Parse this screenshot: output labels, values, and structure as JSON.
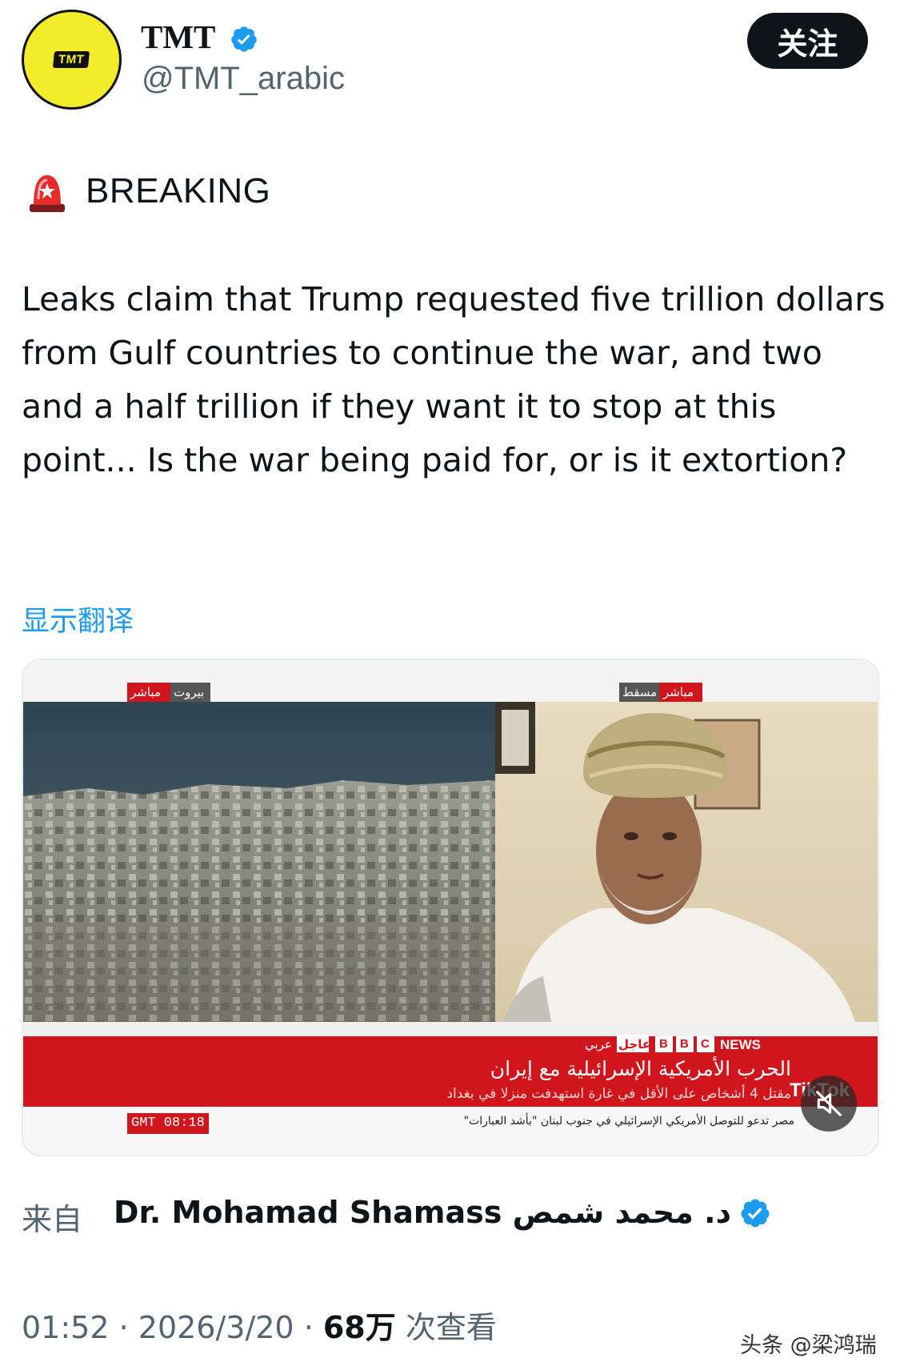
{
  "account": {
    "display_name": "TMT",
    "handle": "@TMT_arabic",
    "avatar_text": "TMT",
    "follow_label": "关注"
  },
  "tweet": {
    "breaking_label": "BREAKING",
    "text": "Leaks claim that Trump requested five trillion dollars from Gulf countries to continue the war, and two and a half trillion if they want it to stop at this point... Is the war being paid for, or is it extortion?",
    "translate_label": "显示翻译"
  },
  "media": {
    "live_tag_left": "مباشر",
    "location_tag_left": "بيروت",
    "live_tag_right": "مباشر",
    "location_tag_right": "مسقط",
    "urgent_tag": "عاجل",
    "channel_lang": "عربي",
    "bbc_letters": [
      "B",
      "B",
      "C"
    ],
    "news_label": "NEWS",
    "headline": "الحرب الأمريكية الإسرائيلية مع إيران",
    "subline": "مقتل 4 أشخاص على الأقل في غارة استهدفت منزلا في بغداد",
    "ticker": "مصر تدعو للتوصل الأمريكي الإسرائيلي في جنوب لبنان \"بأشد العبارات\"",
    "clock": "GMT 08:18",
    "tiktok_label": "TikTok",
    "mute_icon": "speaker-muted-icon"
  },
  "source": {
    "prefix": "来自",
    "name": "Dr. Mohamad Shamass د. محمد شمص"
  },
  "meta": {
    "time": "01:52",
    "sep1": " · ",
    "date": "2026/3/20",
    "sep2": " · ",
    "views": "68万",
    "views_suffix": " 次查看"
  },
  "watermark": "头条 @梁鸿瑞",
  "colors": {
    "verified": "#1d9bf0",
    "link": "#1d9bf0",
    "muted_text": "#536471",
    "bbc_red": "#d0161c"
  }
}
